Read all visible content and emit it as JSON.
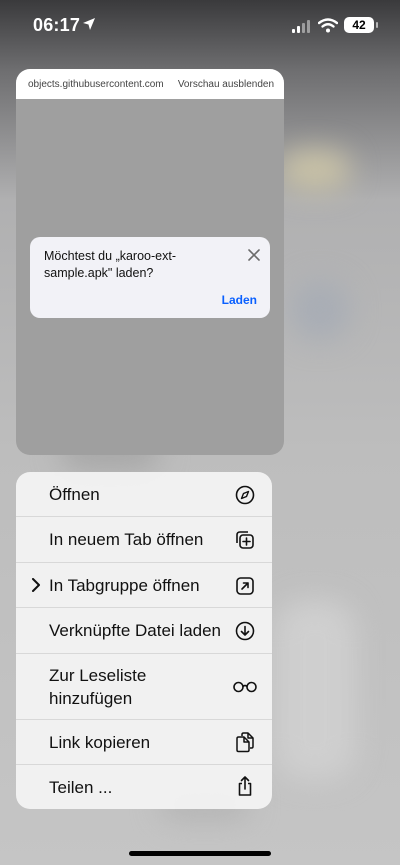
{
  "status_bar": {
    "time": "06:17",
    "battery": "42"
  },
  "preview": {
    "url": "objects.githubusercontent.com",
    "hide_preview": "Vorschau ausblenden",
    "dialog": {
      "message": "Möchtest du „karoo-ext-sample.apk\" laden?",
      "action": "Laden"
    }
  },
  "menu": {
    "items": [
      {
        "label": "Öffnen",
        "icon": "compass-icon"
      },
      {
        "label": "In neuem Tab öffnen",
        "icon": "plus-square-on-square-icon"
      },
      {
        "label": "In Tabgruppe öffnen",
        "icon": "arrow-up-right-square-icon"
      },
      {
        "label": "Verknüpfte Datei laden",
        "icon": "arrow-down-circle-icon"
      },
      {
        "label": "Zur Leseliste hinzufügen",
        "icon": "eyeglasses-icon"
      },
      {
        "label": "Link kopieren",
        "icon": "copy-documents-icon"
      },
      {
        "label": "Teilen ...",
        "icon": "share-icon"
      }
    ]
  }
}
